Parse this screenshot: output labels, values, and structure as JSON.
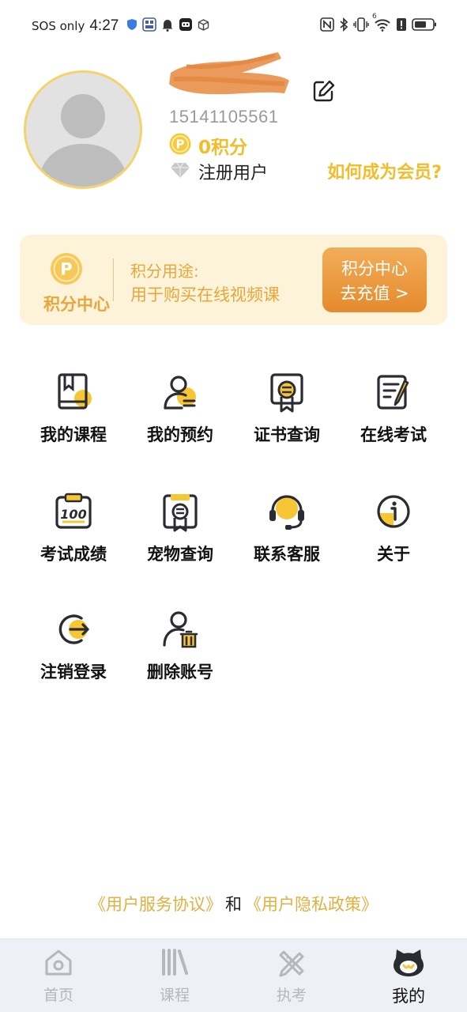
{
  "status_bar": {
    "carrier": "SOS only",
    "time": "4:27",
    "wifi_badge": "6",
    "icons_left": [
      "shield-icon",
      "app-icon",
      "bell-icon",
      "robot-icon",
      "box-icon"
    ],
    "icons_right": [
      "nfc-icon",
      "bluetooth-icon",
      "vibrate-icon",
      "wifi-icon",
      "alert-icon",
      "battery-icon"
    ]
  },
  "profile": {
    "phone": "15141105561",
    "points": "0积分",
    "member_level": "注册用户",
    "how_member_link": "如何成为会员?"
  },
  "points_card": {
    "label": "积分中心",
    "icon_letter": "P",
    "usage_title": "积分用途:",
    "usage_desc": "用于购买在线视频课",
    "button_line1": "积分中心",
    "button_line2": "去充值 >"
  },
  "menu": [
    {
      "label": "我的课程",
      "icon": "course-book-icon"
    },
    {
      "label": "我的预约",
      "icon": "appointment-user-icon"
    },
    {
      "label": "证书查询",
      "icon": "certificate-icon"
    },
    {
      "label": "在线考试",
      "icon": "online-exam-icon"
    },
    {
      "label": "考试成绩",
      "icon": "exam-score-icon"
    },
    {
      "label": "宠物查询",
      "icon": "pet-certificate-icon"
    },
    {
      "label": "联系客服",
      "icon": "headset-icon"
    },
    {
      "label": "关于",
      "icon": "info-icon"
    },
    {
      "label": "注销登录",
      "icon": "logout-icon"
    },
    {
      "label": "删除账号",
      "icon": "delete-account-icon"
    }
  ],
  "agreement": {
    "service": "《用户服务协议》",
    "and": "和",
    "privacy": "《用户隐私政策》"
  },
  "bottom_nav": [
    {
      "label": "首页",
      "icon": "home-icon",
      "active": false
    },
    {
      "label": "课程",
      "icon": "books-icon",
      "active": false
    },
    {
      "label": "执考",
      "icon": "pencil-ruler-icon",
      "active": false
    },
    {
      "label": "我的",
      "icon": "cat-face-icon",
      "active": true
    }
  ],
  "colors": {
    "accent_yellow": "#f2bd2b",
    "card_bg": "#fdf3d8",
    "card_text": "#e8a63c",
    "button_orange": "#e58a2d",
    "nav_bg": "#eef0f6",
    "icon_dark": "#2b2b33"
  }
}
